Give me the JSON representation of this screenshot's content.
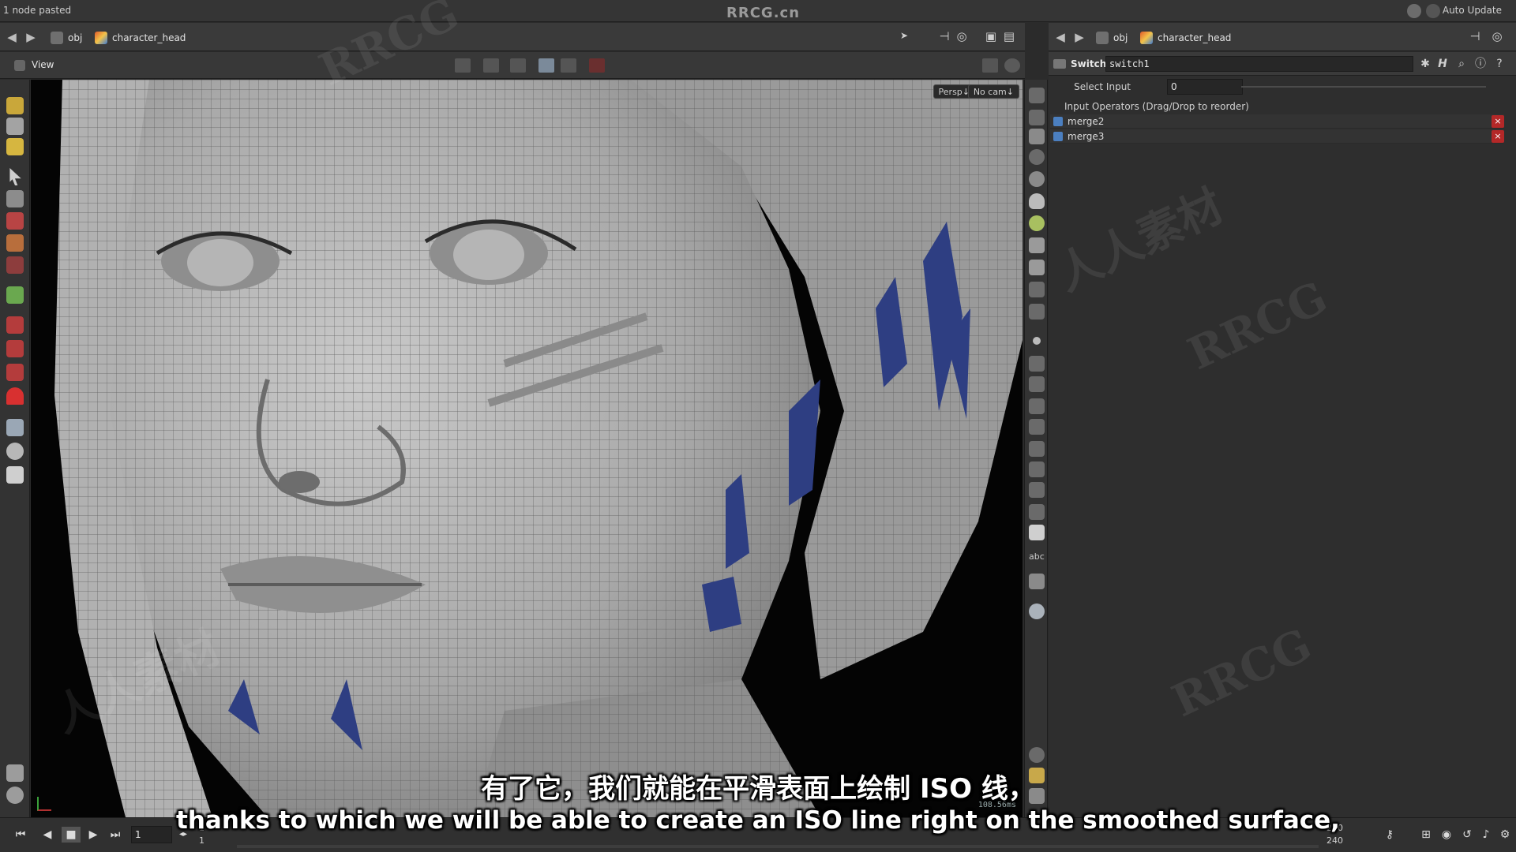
{
  "topbar": {
    "status": "1 node pasted",
    "center_title": "RRCG.cn",
    "auto_update": "Auto Update"
  },
  "left_path": {
    "root": "obj",
    "node": "character_head"
  },
  "right_path": {
    "root": "obj",
    "node": "character_head"
  },
  "viewer": {
    "title": "View",
    "persp": "Persp↓",
    "cam": "No cam↓",
    "render_time": "108.56ms"
  },
  "params": {
    "type": "Switch",
    "node_name": "switch1",
    "select_input_label": "Select Input",
    "select_input_value": "0",
    "section_label": "Input Operators (Drag/Drop to reorder)",
    "inputs": [
      "merge2",
      "merge3"
    ]
  },
  "playbar": {
    "frame": "1",
    "start_a": "1",
    "start_b": "1",
    "end_a": "240",
    "end_b": "240"
  },
  "subtitles": {
    "cn": "有了它，我们就能在平滑表面上绘制 ISO 线，",
    "en": "thanks to which we will be able to create an ISO line right on the smoothed surface,"
  },
  "watermark": {
    "text_a": "RRCG",
    "text_b": "人人素材"
  },
  "colors": {
    "accent_blue": "#4b7fc0",
    "hair_blue": "#2e3e82",
    "remove_red": "#b42828"
  }
}
